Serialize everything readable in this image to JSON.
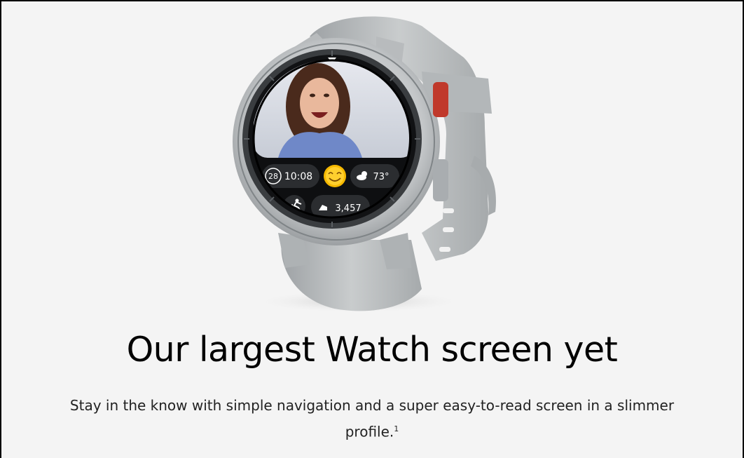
{
  "hero": {
    "title": "Our largest Watch screen yet",
    "description": "Stay in the know with simple navigation and a super easy-to-read screen in a slimmer profile.",
    "footnote_marker": "1"
  },
  "watch_face": {
    "date": "28",
    "time": "10:08",
    "weather": "73°",
    "steps": "3,457",
    "emoji_icon": "smiling-face-emoji",
    "weather_icon": "cloud-sun-icon",
    "steps_icon": "shoe-icon",
    "activity_icon": "running-person-icon"
  },
  "colors": {
    "background": "#f4f4f4",
    "strap": "#b9bcbe",
    "case": "#c8cbcd",
    "accent_button": "#c0392b"
  }
}
